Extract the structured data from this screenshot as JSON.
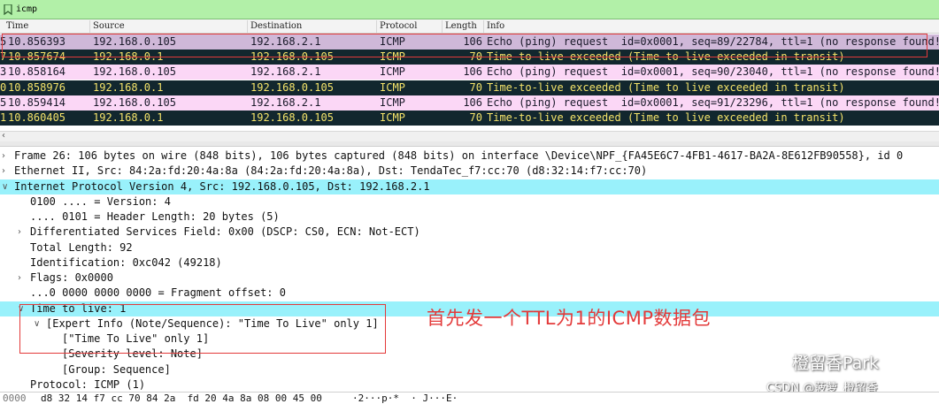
{
  "filter": {
    "value": "icmp"
  },
  "packet_list": {
    "columns": [
      "Time",
      "Source",
      "Destination",
      "Protocol",
      "Length",
      "Info"
    ],
    "rows": [
      {
        "no": "5",
        "time": "10.856393",
        "source": "192.168.0.105",
        "destination": "192.168.2.1",
        "protocol": "ICMP",
        "length": "106",
        "info": "Echo (ping) request  id=0x0001, seq=89/22784, ttl=1 (no response found!)",
        "kind": "request",
        "selected": true
      },
      {
        "no": "7",
        "time": "10.857674",
        "source": "192.168.0.1",
        "destination": "192.168.0.105",
        "protocol": "ICMP",
        "length": "70",
        "info": "Time-to-live exceeded (Time to live exceeded in transit)",
        "kind": "ttl"
      },
      {
        "no": "3",
        "time": "10.858164",
        "source": "192.168.0.105",
        "destination": "192.168.2.1",
        "protocol": "ICMP",
        "length": "106",
        "info": "Echo (ping) request  id=0x0001, seq=90/23040, ttl=1 (no response found!)",
        "kind": "request"
      },
      {
        "no": "0",
        "time": "10.858976",
        "source": "192.168.0.1",
        "destination": "192.168.0.105",
        "protocol": "ICMP",
        "length": "70",
        "info": "Time-to-live exceeded (Time to live exceeded in transit)",
        "kind": "ttl"
      },
      {
        "no": "5",
        "time": "10.859414",
        "source": "192.168.0.105",
        "destination": "192.168.2.1",
        "protocol": "ICMP",
        "length": "106",
        "info": "Echo (ping) request  id=0x0001, seq=91/23296, ttl=1 (no response found!)",
        "kind": "request"
      },
      {
        "no": "1",
        "time": "10.860405",
        "source": "192.168.0.1",
        "destination": "192.168.0.105",
        "protocol": "ICMP",
        "length": "70",
        "info": "Time-to-live exceeded (Time to live exceeded in transit)",
        "kind": "ttl"
      }
    ]
  },
  "details": [
    {
      "text": "Frame 26: 106 bytes on wire (848 bits), 106 bytes captured (848 bits) on interface \\Device\\NPF_{FA45E6C7-4FB1-4617-BA2A-8E612FB90558}, id 0",
      "twisty": ">",
      "level": 0
    },
    {
      "text": "Ethernet II, Src: 84:2a:fd:20:4a:8a (84:2a:fd:20:4a:8a), Dst: TendaTec_f7:cc:70 (d8:32:14:f7:cc:70)",
      "twisty": ">",
      "level": 0
    },
    {
      "text": "Internet Protocol Version 4, Src: 192.168.0.105, Dst: 192.168.2.1",
      "twisty": "v",
      "level": 0,
      "highlight": true
    },
    {
      "text": "0100 .... = Version: 4",
      "twisty": "",
      "level": 1
    },
    {
      "text": ".... 0101 = Header Length: 20 bytes (5)",
      "twisty": "",
      "level": 1
    },
    {
      "text": "Differentiated Services Field: 0x00 (DSCP: CS0, ECN: Not-ECT)",
      "twisty": ">",
      "level": 1
    },
    {
      "text": "Total Length: 92",
      "twisty": "",
      "level": 1
    },
    {
      "text": "Identification: 0xc042 (49218)",
      "twisty": "",
      "level": 1
    },
    {
      "text": "Flags: 0x0000",
      "twisty": ">",
      "level": 1
    },
    {
      "text": "...0 0000 0000 0000 = Fragment offset: 0",
      "twisty": "",
      "level": 1
    },
    {
      "text": "Time to live: 1",
      "twisty": "v",
      "level": 1,
      "highlight": true
    },
    {
      "text": "[Expert Info (Note/Sequence): \"Time To Live\" only 1]",
      "twisty": "v",
      "level": 2
    },
    {
      "text": "[\"Time To Live\" only 1]",
      "twisty": "",
      "level": 3
    },
    {
      "text": "[Severity level: Note]",
      "twisty": "",
      "level": 3
    },
    {
      "text": "[Group: Sequence]",
      "twisty": "",
      "level": 3
    },
    {
      "text": "Protocol: ICMP (1)",
      "twisty": "",
      "level": 1
    }
  ],
  "annotation": {
    "text": "首先发一个TTL为1的ICMP数据包"
  },
  "watermark": {
    "name": "橙留香Park",
    "credit": "CSDN @菠萝_橙留香"
  },
  "bytes": {
    "offset": "0000",
    "hex": "d8 32 14 f7 cc 70 84 2a  fd 20 4a 8a 08 00 45 00",
    "ascii": "·2···p·*  · J···E·"
  },
  "colors": {
    "filter_bg": "#b2f0a8",
    "request_row": "#fbd7f6",
    "ttl_row": "#12272e",
    "ttl_text": "#f4e36a",
    "highlight": "#99f1fb",
    "annotation": "#e33a3a"
  },
  "icons": {
    "filter_bookmark": "bookmark-icon",
    "watermark_logo": "wechat-logo-icon"
  }
}
